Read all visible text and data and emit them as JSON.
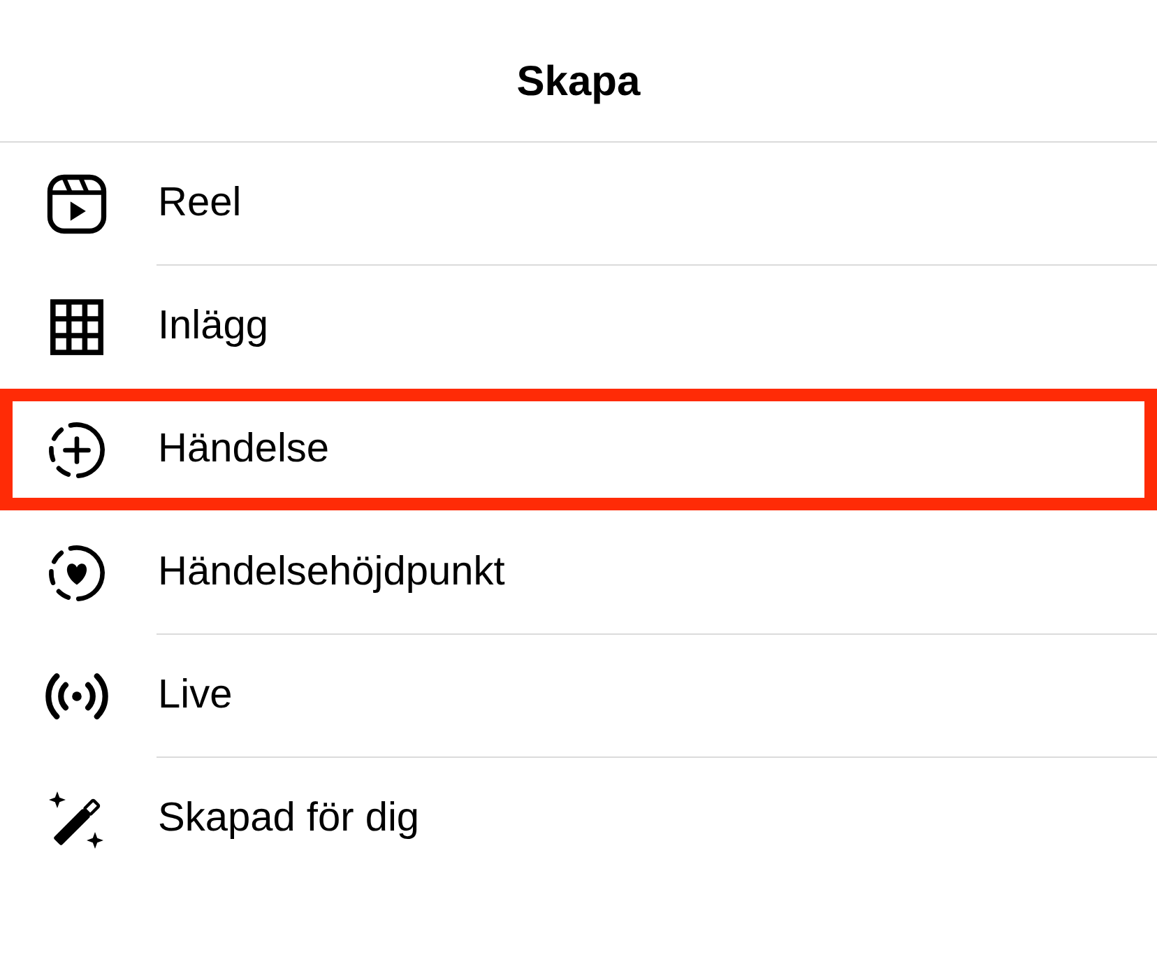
{
  "header": {
    "title": "Skapa"
  },
  "items": [
    {
      "kind": "reel",
      "label": "Reel",
      "highlighted": false
    },
    {
      "kind": "grid",
      "label": "Inlägg",
      "highlighted": false
    },
    {
      "kind": "story-add",
      "label": "Händelse",
      "highlighted": true
    },
    {
      "kind": "story-heart",
      "label": "Händelsehöjdpunkt",
      "highlighted": false
    },
    {
      "kind": "live",
      "label": "Live",
      "highlighted": false
    },
    {
      "kind": "wand",
      "label": "Skapad för dig",
      "highlighted": false
    }
  ]
}
